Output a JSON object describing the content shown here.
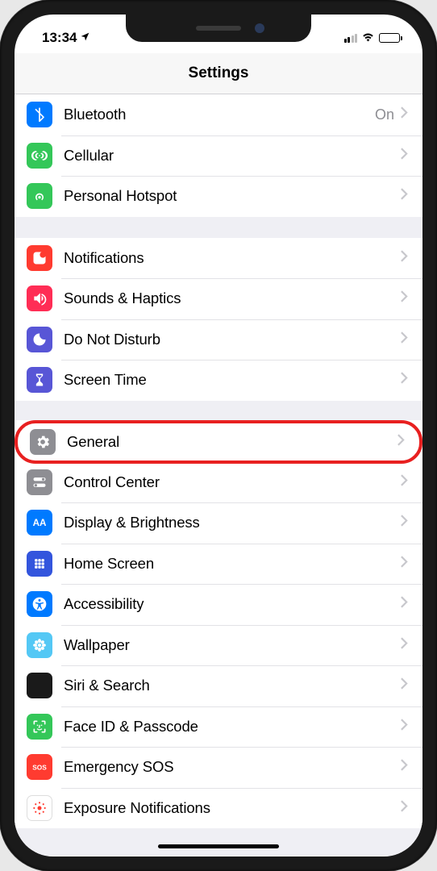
{
  "status": {
    "time": "13:34"
  },
  "header": {
    "title": "Settings"
  },
  "groups": [
    {
      "rows": [
        {
          "id": "bluetooth",
          "label": "Bluetooth",
          "value": "On",
          "icon": "bluetooth",
          "color": "#007aff"
        },
        {
          "id": "cellular",
          "label": "Cellular",
          "icon": "antenna",
          "color": "#34c759"
        },
        {
          "id": "hotspot",
          "label": "Personal Hotspot",
          "icon": "hotspot",
          "color": "#34c759"
        }
      ]
    },
    {
      "rows": [
        {
          "id": "notifications",
          "label": "Notifications",
          "icon": "notifications",
          "color": "#ff3b30"
        },
        {
          "id": "sounds",
          "label": "Sounds & Haptics",
          "icon": "sounds",
          "color": "#ff2d55"
        },
        {
          "id": "dnd",
          "label": "Do Not Disturb",
          "icon": "moon",
          "color": "#5856d6"
        },
        {
          "id": "screentime",
          "label": "Screen Time",
          "icon": "hourglass",
          "color": "#5856d6"
        }
      ]
    },
    {
      "rows": [
        {
          "id": "general",
          "label": "General",
          "icon": "gear",
          "color": "#8e8e93",
          "highlight": true
        },
        {
          "id": "controlcenter",
          "label": "Control Center",
          "icon": "switches",
          "color": "#8e8e93"
        },
        {
          "id": "display",
          "label": "Display & Brightness",
          "icon": "aa",
          "color": "#007aff"
        },
        {
          "id": "homescreen",
          "label": "Home Screen",
          "icon": "grid",
          "color": "#3355dd"
        },
        {
          "id": "accessibility",
          "label": "Accessibility",
          "icon": "accessibility",
          "color": "#007aff"
        },
        {
          "id": "wallpaper",
          "label": "Wallpaper",
          "icon": "flower",
          "color": "#54c8f5"
        },
        {
          "id": "siri",
          "label": "Siri & Search",
          "icon": "siri",
          "color": "#1a1a1a"
        },
        {
          "id": "faceid",
          "label": "Face ID & Passcode",
          "icon": "faceid",
          "color": "#34c759"
        },
        {
          "id": "sos",
          "label": "Emergency SOS",
          "icon": "sos",
          "color": "#ff3b30"
        },
        {
          "id": "exposure",
          "label": "Exposure Notifications",
          "icon": "exposure",
          "color": "#ffffff",
          "iconcolor": "#ff3b30",
          "border": true
        }
      ]
    }
  ]
}
